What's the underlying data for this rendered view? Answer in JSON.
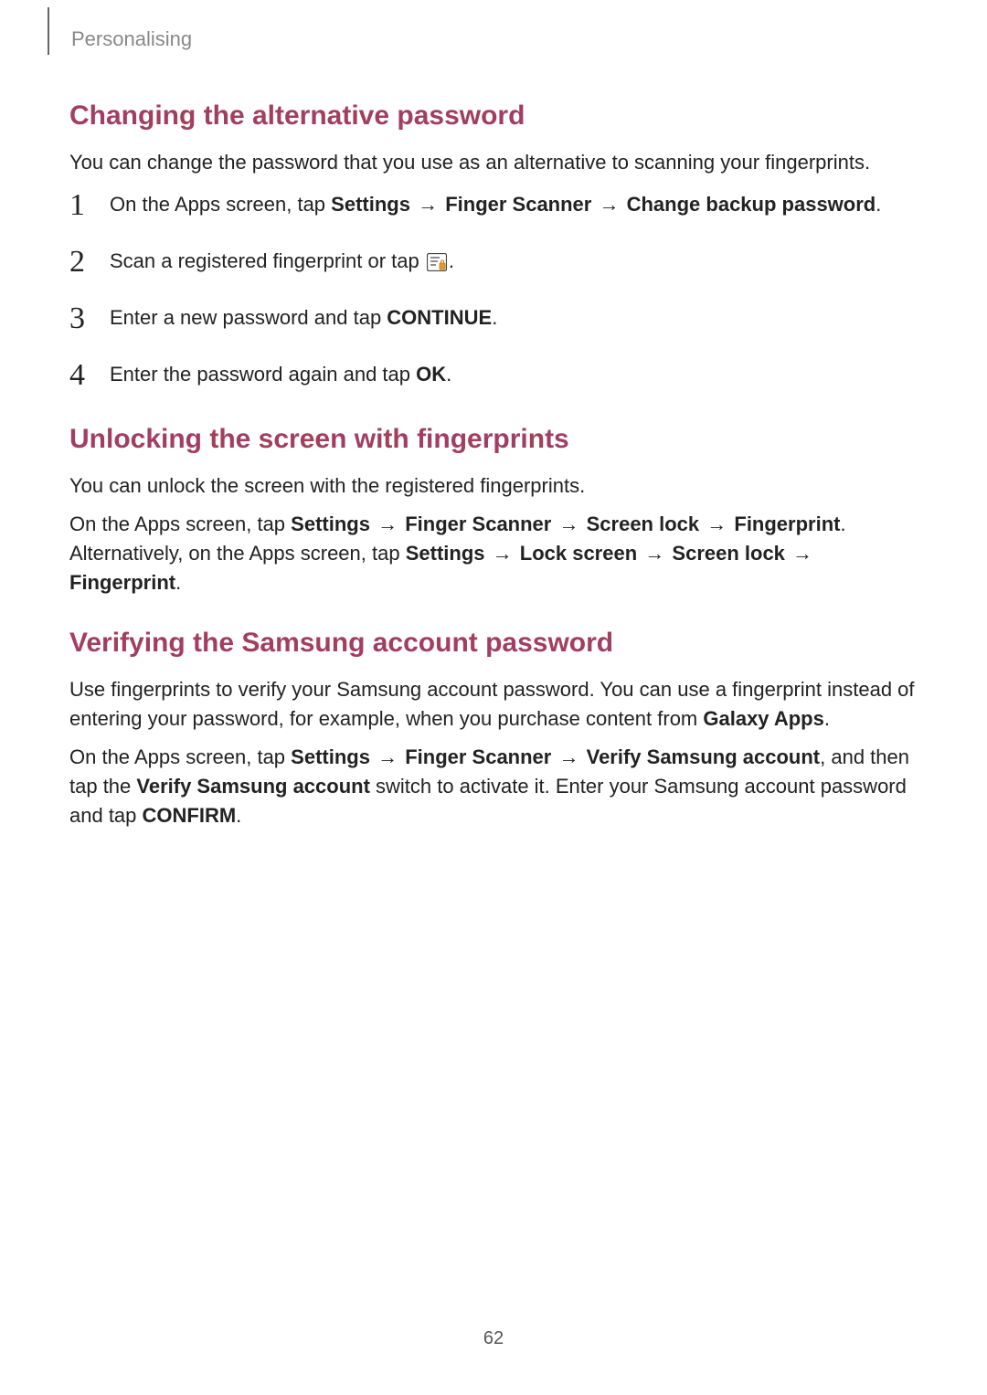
{
  "header": {
    "breadcrumb": "Personalising"
  },
  "page_number": "62",
  "arrow": "→",
  "sections": {
    "s1": {
      "heading": "Changing the alternative password",
      "intro": "You can change the password that you use as an alternative to scanning your fingerprints.",
      "steps": {
        "n1": "1",
        "n2": "2",
        "n3": "3",
        "n4": "4",
        "step1_pre": "On the Apps screen, tap ",
        "step1_b1": "Settings",
        "step1_b2": "Finger Scanner",
        "step1_b3": "Change backup password",
        "step1_post": ".",
        "step2_pre": "Scan a registered fingerprint or tap ",
        "step2_post": ".",
        "step3_pre": "Enter a new password and tap ",
        "step3_b1": "CONTINUE",
        "step3_post": ".",
        "step4_pre": "Enter the password again and tap ",
        "step4_b1": "OK",
        "step4_post": "."
      }
    },
    "s2": {
      "heading": "Unlocking the screen with fingerprints",
      "p1": "You can unlock the screen with the registered fingerprints.",
      "p2_pre": "On the Apps screen, tap ",
      "p2_b1": "Settings",
      "p2_b2": "Finger Scanner",
      "p2_b3": "Screen lock",
      "p2_b4": "Fingerprint",
      "p2_mid": ". Alternatively, on the Apps screen, tap ",
      "p2_b5": "Settings",
      "p2_b6": "Lock screen",
      "p2_b7": "Screen lock",
      "p2_b8": "Fingerprint",
      "p2_post": "."
    },
    "s3": {
      "heading": "Verifying the Samsung account password",
      "p1_pre": "Use fingerprints to verify your Samsung account password. You can use a fingerprint instead of entering your password, for example, when you purchase content from ",
      "p1_b1": "Galaxy Apps",
      "p1_post": ".",
      "p2_pre": "On the Apps screen, tap ",
      "p2_b1": "Settings",
      "p2_b2": "Finger Scanner",
      "p2_b3": "Verify Samsung account",
      "p2_mid1": ", and then tap the ",
      "p2_b4": "Verify Samsung account",
      "p2_mid2": " switch to activate it. Enter your Samsung account password and tap ",
      "p2_b5": "CONFIRM",
      "p2_post": "."
    }
  }
}
